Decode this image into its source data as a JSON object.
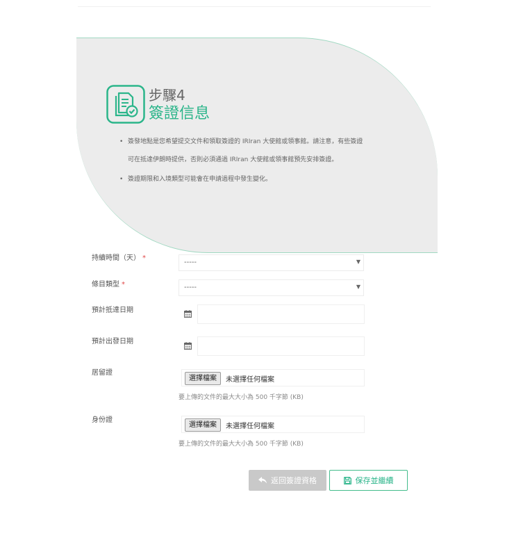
{
  "step": {
    "label": "步驟4",
    "title": "簽證信息",
    "icon": "document-check-icon"
  },
  "notes": [
    {
      "lines": [
        "簽發地點是您希望提交文件和領取簽證的 IRIran 大使館或領事館。請注意，有些簽證",
        "可在抵達伊朗時提供，否則必須通過 IRIran 大使館或領事館預先安排簽證。"
      ]
    },
    {
      "lines": [
        "簽證期限和入境類型可能會在申請過程中發生變化。"
      ]
    }
  ],
  "form": {
    "required_mark": "*",
    "duration": {
      "label": "持續時間（天）",
      "value": "-----"
    },
    "entry_type": {
      "label": "條目類型",
      "value": "-----"
    },
    "arrival_date": {
      "label": "預計抵達日期",
      "value": ""
    },
    "departure_date": {
      "label": "預計出發日期",
      "value": ""
    },
    "residence_permit": {
      "label": "居留證",
      "button": "選擇檔案",
      "status": "未選擇任何檔案",
      "hint": "要上傳的文件的最大大小為 500 千字節 (KB)"
    },
    "id_card": {
      "label": "身份證",
      "button": "選擇檔案",
      "status": "未選擇任何檔案",
      "hint": "要上傳的文件的最大大小為 500 千字節 (KB)"
    }
  },
  "actions": {
    "back": {
      "label": "返回簽證資格",
      "icon": "reply-arrow-icon"
    },
    "save": {
      "label": "保存並繼續",
      "icon": "floppy-disk-icon"
    }
  },
  "colors": {
    "accent": "#2bb58a",
    "hero_bg": "#ececec",
    "required": "#e04848",
    "disabled_button": "#c9c9c9"
  }
}
